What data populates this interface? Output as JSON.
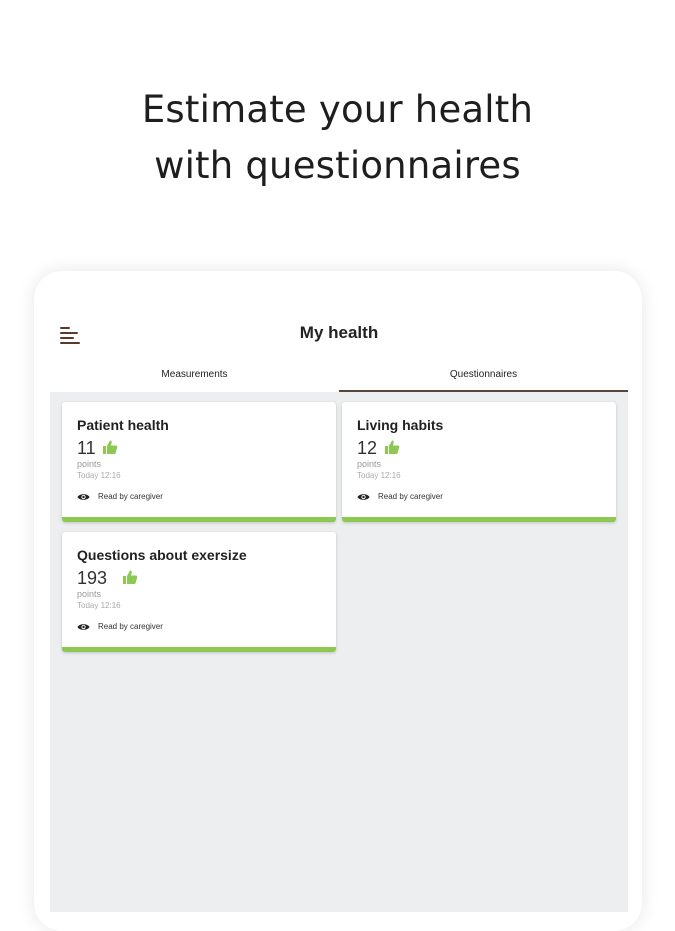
{
  "headline": {
    "line1": "Estimate your health",
    "line2": "with questionnaires"
  },
  "app": {
    "title": "My health",
    "menu_icon": "hamburger-menu-icon"
  },
  "tabs": [
    {
      "label": "Measurements",
      "active": false
    },
    {
      "label": "Questionnaires",
      "active": true
    }
  ],
  "cards": [
    {
      "title": "Patient health",
      "score": "11",
      "unit": "points",
      "time": "Today 12:16",
      "status": "Read by caregiver",
      "icon": "thumbs-up-icon"
    },
    {
      "title": "Living habits",
      "score": "12",
      "unit": "points",
      "time": "Today 12:16",
      "status": "Read by caregiver",
      "icon": "thumbs-up-icon"
    },
    {
      "title": "Questions about exersize",
      "score": "193",
      "unit": "points",
      "time": "Today 12:16",
      "status": "Read by caregiver",
      "icon": "thumbs-up-icon"
    }
  ],
  "colors": {
    "accent_green": "#8dc852",
    "tab_indicator": "#5a4638",
    "content_bg": "#eceeef"
  }
}
